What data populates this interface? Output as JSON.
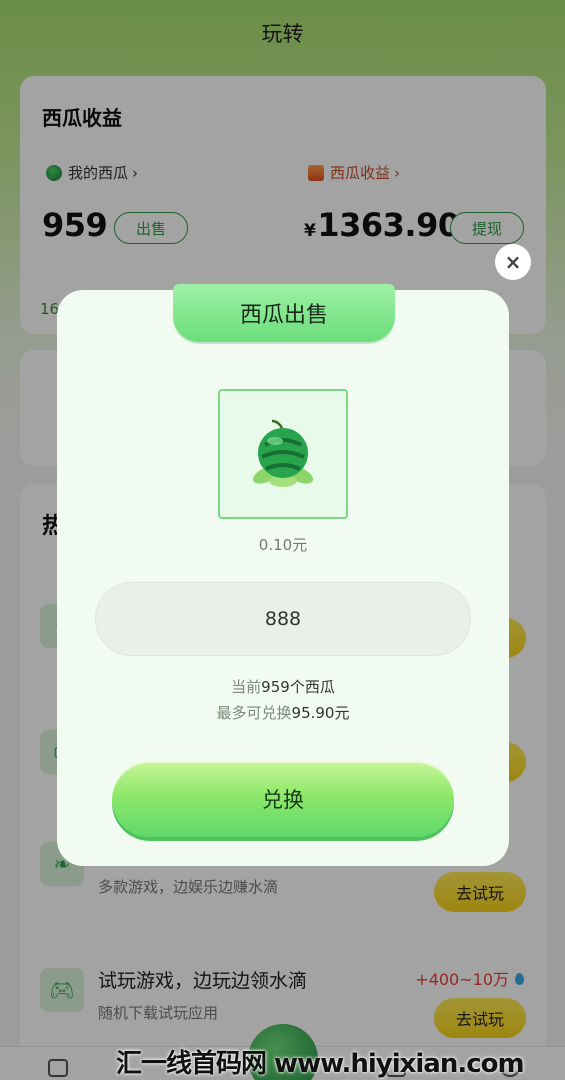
{
  "header": {
    "title": "玩转"
  },
  "earnings": {
    "title": "西瓜收益",
    "my_melon_label": "我的西瓜",
    "melon_income_label": "西瓜收益",
    "melon_count": "959",
    "sell_label": "出售",
    "currency": "¥",
    "income_amount": "1363.90",
    "withdraw_label": "提现",
    "footer_partial": "16"
  },
  "hot": {
    "title_partial": "热",
    "tasks": [
      {
        "title": "",
        "subtitle": "",
        "reward": "",
        "button": ""
      },
      {
        "title": "",
        "subtitle": "",
        "reward": "",
        "button": ""
      },
      {
        "title": "",
        "subtitle": "多款游戏，边娱乐边赚水滴",
        "reward": "",
        "button": "去试玩"
      },
      {
        "title": "试玩游戏，边玩边领水滴",
        "subtitle": "随机下载试玩应用",
        "reward": "+400~10万",
        "button": "去试玩"
      }
    ]
  },
  "dialog": {
    "title": "西瓜出售",
    "unit_price": "0.10元",
    "quantity_value": "888",
    "current_prefix": "当前",
    "current_count": "959",
    "current_suffix": "个西瓜",
    "max_prefix": "最多可兑换",
    "max_amount": "95.90元",
    "exchange_label": "兑换",
    "close_symbol": "×"
  },
  "watermark": {
    "text": "汇一线首码网 www.hiyixian.com"
  },
  "icons": {
    "melon": "watermelon-icon",
    "gift": "gift-icon",
    "close": "close-icon",
    "drop": "water-drop-icon",
    "game": "gamepad-icon",
    "leaf": "leaf-icon"
  }
}
